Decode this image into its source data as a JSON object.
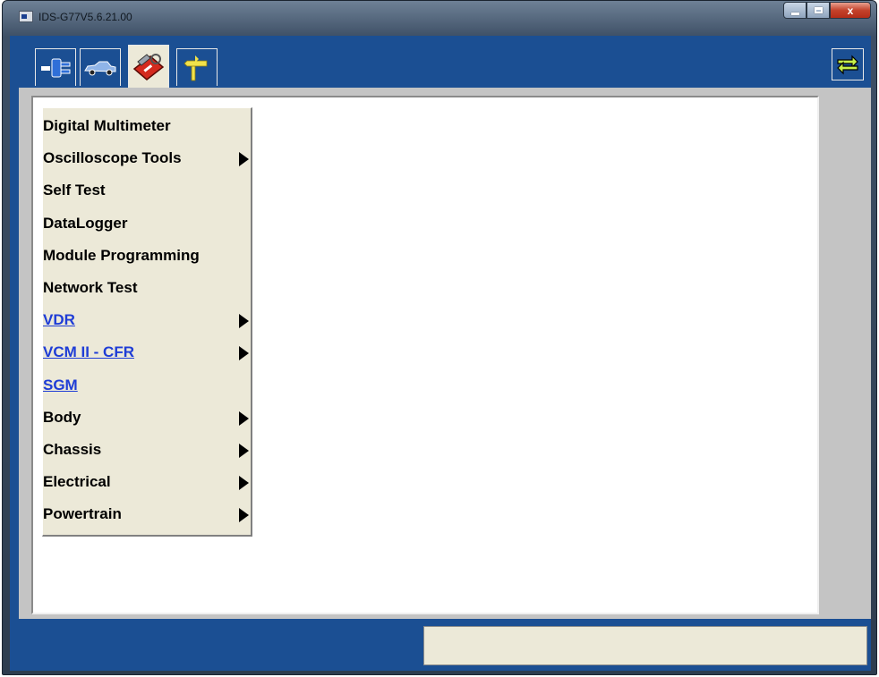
{
  "window": {
    "title": "IDS-G77V5.6.21.00",
    "min_glyph": "",
    "max_glyph": "",
    "close_glyph": "x"
  },
  "tabs": [
    {
      "icon": "connector-plug-icon",
      "active": false
    },
    {
      "icon": "vehicle-car-icon",
      "active": false
    },
    {
      "icon": "toolbox-icon",
      "active": true
    },
    {
      "icon": "signpost-icon",
      "active": false
    }
  ],
  "toolbar_right": {
    "icon": "swap-arrows-icon"
  },
  "menu": {
    "items": [
      {
        "label": "Digital Multimeter",
        "link": false,
        "submenu": false
      },
      {
        "label": "Oscilloscope Tools",
        "link": false,
        "submenu": true
      },
      {
        "label": "Self Test",
        "link": false,
        "submenu": false
      },
      {
        "label": "DataLogger",
        "link": false,
        "submenu": false
      },
      {
        "label": "Module Programming",
        "link": false,
        "submenu": false
      },
      {
        "label": "Network Test",
        "link": false,
        "submenu": false
      },
      {
        "label": "VDR",
        "link": true,
        "submenu": true
      },
      {
        "label": "VCM II - CFR",
        "link": true,
        "submenu": true
      },
      {
        "label": "SGM",
        "link": true,
        "submenu": false
      },
      {
        "label": "Body",
        "link": false,
        "submenu": true
      },
      {
        "label": "Chassis",
        "link": false,
        "submenu": true
      },
      {
        "label": "Electrical",
        "link": false,
        "submenu": true
      },
      {
        "label": "Powertrain",
        "link": false,
        "submenu": true
      }
    ]
  },
  "status": {
    "text": ""
  },
  "colors": {
    "client_blue": "#1b4f93",
    "menu_bg": "#ece9d8",
    "link_blue": "#1f3dd6"
  }
}
